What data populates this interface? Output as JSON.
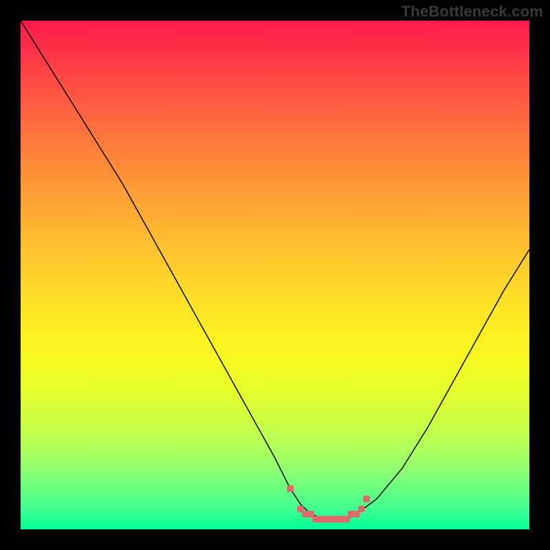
{
  "watermark": "TheBottleneck.com",
  "chart_data": {
    "type": "line",
    "title": "",
    "xlabel": "",
    "ylabel": "",
    "xlim": [
      0,
      100
    ],
    "ylim": [
      0,
      100
    ],
    "grid": false,
    "legend": false,
    "gradient_colors": {
      "top": "#ff1a4a",
      "middle": "#ffdd28",
      "bottom": "#00ff9a"
    },
    "curve": {
      "description": "Black V-shaped bottleneck curve with flat basin and pink highlight markers near the minimum",
      "x": [
        0,
        5,
        10,
        15,
        20,
        25,
        30,
        35,
        40,
        45,
        50,
        53,
        55,
        57,
        60,
        62,
        64,
        66,
        70,
        75,
        80,
        85,
        90,
        95,
        100
      ],
      "y": [
        100,
        92,
        84,
        76,
        68,
        59,
        50,
        41,
        32,
        23,
        14,
        8,
        5,
        3,
        2,
        2,
        2,
        3,
        6,
        12,
        20,
        29,
        38,
        47,
        55
      ]
    },
    "markers": {
      "color": "#e06a6a",
      "x": [
        53,
        55,
        56,
        57,
        58,
        59,
        60,
        61,
        62,
        63,
        64,
        65,
        66,
        67,
        68
      ],
      "y": [
        8,
        4,
        3,
        3,
        2,
        2,
        2,
        2,
        2,
        2,
        2,
        3,
        3,
        4,
        6
      ]
    }
  }
}
